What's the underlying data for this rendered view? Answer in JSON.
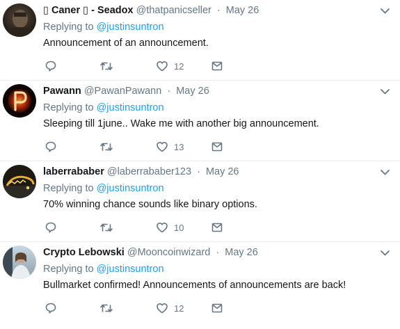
{
  "tweets": [
    {
      "name": "▯ Caner ▯ - Seadox",
      "handle": "@thatpanicseller",
      "date": "May 26",
      "replying_prefix": "Replying to ",
      "replying_to": "@justinsuntron",
      "text": "Announcement of an announcement.",
      "likes": "12",
      "avatar_icon": "avatar-dark-portrait"
    },
    {
      "name": "Pawann",
      "handle": "@PawanPawann",
      "date": "May 26",
      "replying_prefix": "Replying to ",
      "replying_to": "@justinsuntron",
      "text": "Sleeping till 1june.. Wake me with another big announcement.",
      "likes": "13",
      "avatar_icon": "avatar-fiery-p"
    },
    {
      "name": "laberrababer",
      "handle": "@laberrababer123",
      "date": "May 26",
      "replying_prefix": "Replying to ",
      "replying_to": "@justinsuntron",
      "text": "70% winning chance sounds like binary options.",
      "likes": "10",
      "avatar_icon": "avatar-neon-sign"
    },
    {
      "name": "Crypto Lebowski",
      "handle": "@Mooncoinwizard",
      "date": "May 26",
      "replying_prefix": "Replying to ",
      "replying_to": "@justinsuntron",
      "text": "Bullmarket confirmed! Announcements of announcements are back!",
      "likes": "12",
      "avatar_icon": "avatar-person-photo"
    }
  ],
  "colors": {
    "text": "#14171a",
    "secondary": "#657786",
    "link": "#1da1f2",
    "divider": "#e6ecf0"
  },
  "icons": [
    "reply-icon",
    "retweet-icon",
    "like-icon",
    "direct-message-icon",
    "chevron-down-icon"
  ]
}
